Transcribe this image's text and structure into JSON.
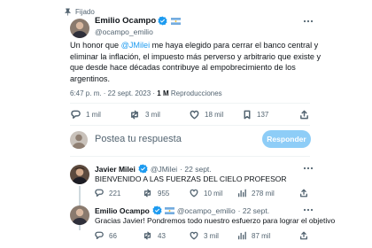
{
  "pinned": {
    "label": "Fijado"
  },
  "main_tweet": {
    "name": "Emilio Ocampo",
    "handle": "@ocampo_emilio",
    "text_before": "Un honor que ",
    "mention": "@JMilei",
    "text_line1_rest": " me haya elegido para cerrar el banco central y",
    "text_line2": "eliminar la inflación, el impuesto más perverso y arbitrario que existe y",
    "text_line3": "que desde hace décadas contribuye al empobrecimiento de los",
    "text_line4": "argentinos.",
    "time": "6:47 p. m. · 22 sept. 2023 · ",
    "views_count": "1 M",
    "views_label": " Reproducciones",
    "replies": "1 mil",
    "retweets": "3 mil",
    "likes": "18 mil",
    "bookmarks": "137"
  },
  "reply_box": {
    "placeholder": "Postea tu respuesta",
    "button": "Responder"
  },
  "replies": [
    {
      "name": "Javier Milei",
      "handle": "@JMilei",
      "date": "· 22 sept.",
      "text": "BIENVENIDO A LAS FUERZAS DEL CIELO PROFESOR",
      "replies": "221",
      "retweets": "955",
      "likes": "10 mil",
      "views": "278 mil"
    },
    {
      "name": "Emilio Ocampo",
      "handle": "@ocampo_emilio",
      "date": "· 22 sept.",
      "text": "Gracias Javier! Pondremos todo nuestro esfuerzo para lograr el objetivo",
      "replies": "66",
      "retweets": "43",
      "likes": "3 mil",
      "views": "87 mil"
    }
  ],
  "colors": {
    "accent": "#1d9bf0",
    "verified": "#1d9bf0",
    "button_bg": "#8ecdf7",
    "text": "#0f1419",
    "muted": "#536471"
  },
  "icons": {
    "pin": "pin-icon",
    "more": "more-icon",
    "reply": "reply-icon",
    "retweet": "retweet-icon",
    "like": "like-icon",
    "bookmark": "bookmark-icon",
    "views": "views-icon",
    "share": "share-icon"
  }
}
